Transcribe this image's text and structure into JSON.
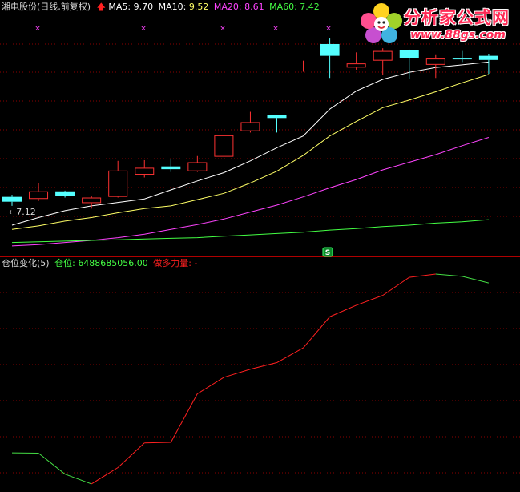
{
  "main_panel": {
    "stock_name": "湘电股份",
    "period": "(日线,前复权)",
    "indicators": [
      {
        "label": "MA5:",
        "value": "9.70",
        "color": "#ffffff"
      },
      {
        "label": "MA10:",
        "value": "9.52",
        "color": "#ffff66"
      },
      {
        "label": "MA20:",
        "value": "8.61",
        "color": "#ff44ff"
      },
      {
        "label": "MA60:",
        "value": "7.42",
        "color": "#44ff44"
      }
    ],
    "low_marker": "←7.12",
    "signal_badge": "S"
  },
  "sub_panel": {
    "title": "仓位变化(5)",
    "position_label": "仓位:",
    "position_value": "6488685056.00",
    "force_label": "做多力量:",
    "force_value": "-"
  },
  "logo": {
    "name": "分析家公式网",
    "url": "www.88gs.com"
  },
  "colors": {
    "up": "#ff3232",
    "down": "#54ffff",
    "grid": "#8b0000",
    "ma5": "#ffffff",
    "ma10": "#ffff66",
    "ma20": "#ff44ff",
    "ma60": "#44ff44",
    "rising_line": "#ff2020",
    "falling_line": "#44dd44"
  },
  "chart_data": [
    {
      "type": "candlestick",
      "price_range": [
        6.9,
        10.4
      ],
      "candles": [
        {
          "o": 7.75,
          "h": 7.78,
          "l": 7.62,
          "c": 7.68
        },
        {
          "o": 7.72,
          "h": 7.95,
          "l": 7.69,
          "c": 7.83
        },
        {
          "o": 7.83,
          "h": 7.84,
          "l": 7.74,
          "c": 7.76
        },
        {
          "o": 7.66,
          "h": 7.76,
          "l": 7.58,
          "c": 7.74
        },
        {
          "o": 7.75,
          "h": 8.27,
          "l": 7.74,
          "c": 8.13
        },
        {
          "o": 8.07,
          "h": 8.28,
          "l": 8.03,
          "c": 8.17
        },
        {
          "o": 8.19,
          "h": 8.29,
          "l": 8.11,
          "c": 8.15
        },
        {
          "o": 8.12,
          "h": 8.34,
          "l": 8.11,
          "c": 8.25
        },
        {
          "o": 8.33,
          "h": 8.65,
          "l": 8.33,
          "c": 8.64
        },
        {
          "o": 8.7,
          "h": 8.98,
          "l": 8.68,
          "c": 8.83
        },
        {
          "o": 8.93,
          "h": 8.94,
          "l": 8.68,
          "c": 8.89
        },
        {
          "o": 9.72,
          "h": 9.72,
          "l": 9.56,
          "c": 9.72
        },
        {
          "o": 9.96,
          "h": 10.04,
          "l": 9.47,
          "c": 9.79
        },
        {
          "o": 9.62,
          "h": 9.84,
          "l": 9.59,
          "c": 9.68
        },
        {
          "o": 9.72,
          "h": 9.9,
          "l": 9.51,
          "c": 9.86
        },
        {
          "o": 9.87,
          "h": 9.88,
          "l": 9.45,
          "c": 9.76
        },
        {
          "o": 9.66,
          "h": 9.8,
          "l": 9.47,
          "c": 9.75
        },
        {
          "o": 9.75,
          "h": 9.86,
          "l": 9.7,
          "c": 9.74
        },
        {
          "o": 9.79,
          "h": 9.81,
          "l": 9.53,
          "c": 9.73
        }
      ],
      "ma": {
        "MA5": [
          7.34,
          7.45,
          7.55,
          7.62,
          7.67,
          7.72,
          7.85,
          7.98,
          8.1,
          8.27,
          8.46,
          8.63,
          9.02,
          9.28,
          9.45,
          9.55,
          9.62,
          9.66,
          9.7
        ],
        "MA10": [
          7.28,
          7.33,
          7.4,
          7.45,
          7.52,
          7.58,
          7.62,
          7.71,
          7.8,
          7.95,
          8.12,
          8.35,
          8.63,
          8.84,
          9.04,
          9.15,
          9.27,
          9.4,
          9.52
        ],
        "MA20": [
          7.04,
          7.06,
          7.09,
          7.12,
          7.16,
          7.21,
          7.28,
          7.35,
          7.43,
          7.53,
          7.63,
          7.75,
          7.88,
          8.0,
          8.14,
          8.25,
          8.36,
          8.49,
          8.61
        ],
        "MA60": [
          7.09,
          7.1,
          7.11,
          7.12,
          7.13,
          7.14,
          7.15,
          7.16,
          7.18,
          7.2,
          7.22,
          7.24,
          7.27,
          7.29,
          7.32,
          7.34,
          7.37,
          7.39,
          7.42
        ]
      }
    },
    {
      "type": "line",
      "name": "仓位",
      "values": [
        100,
        99,
        35,
        5,
        55,
        130,
        132,
        280,
        330,
        355,
        375,
        420,
        515,
        550,
        580,
        635,
        645,
        638,
        618
      ]
    }
  ]
}
